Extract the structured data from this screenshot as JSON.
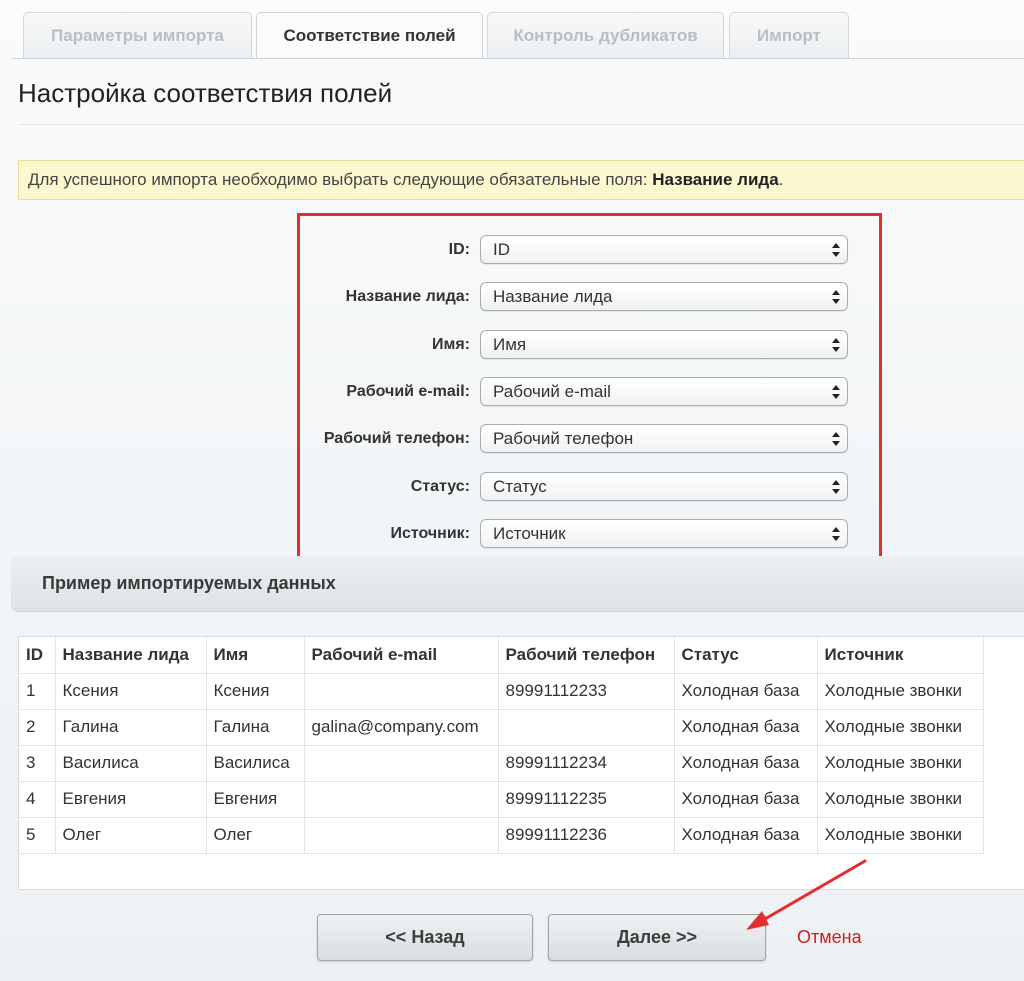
{
  "tabs": [
    {
      "label": "Параметры импорта",
      "active": false
    },
    {
      "label": "Соответствие полей",
      "active": true
    },
    {
      "label": "Контроль дубликатов",
      "active": false
    },
    {
      "label": "Импорт",
      "active": false
    }
  ],
  "page": {
    "title": "Настройка соответствия полей"
  },
  "notice": {
    "text": "Для успешного импорта необходимо выбрать следующие обязательные поля: ",
    "required_field": "Название лида",
    "suffix": "."
  },
  "mapping": {
    "rows": [
      {
        "label": "ID:",
        "value": "ID"
      },
      {
        "label": "Название лида:",
        "value": "Название лида"
      },
      {
        "label": "Имя:",
        "value": "Имя"
      },
      {
        "label": "Рабочий e-mail:",
        "value": "Рабочий e-mail"
      },
      {
        "label": "Рабочий телефон:",
        "value": "Рабочий телефон"
      },
      {
        "label": "Статус:",
        "value": "Статус"
      },
      {
        "label": "Источник:",
        "value": "Источник"
      }
    ]
  },
  "preview": {
    "title": "Пример импортируемых данных",
    "columns": [
      "ID",
      "Название лида",
      "Имя",
      "Рабочий e-mail",
      "Рабочий телефон",
      "Статус",
      "Источник"
    ],
    "rows": [
      [
        "1",
        "Ксения",
        "Ксения",
        "",
        "89991112233",
        "Холодная база",
        "Холодные звонки"
      ],
      [
        "2",
        "Галина",
        "Галина",
        "galina@company.com",
        "",
        "Холодная база",
        "Холодные звонки"
      ],
      [
        "3",
        "Василиса",
        "Василиса",
        "",
        "89991112234",
        "Холодная база",
        "Холодные звонки"
      ],
      [
        "4",
        "Евгения",
        "Евгения",
        "",
        "89991112235",
        "Холодная база",
        "Холодные звонки"
      ],
      [
        "5",
        "Олег",
        "Олег",
        "",
        "89991112236",
        "Холодная база",
        "Холодные звонки"
      ]
    ]
  },
  "buttons": {
    "back": "<< Назад",
    "next": "Далее >>",
    "cancel": "Отмена"
  },
  "colors": {
    "highlight_border": "#e52d2d",
    "notice_bg": "#fbf8d0",
    "cancel_link": "#cc1f1f"
  }
}
